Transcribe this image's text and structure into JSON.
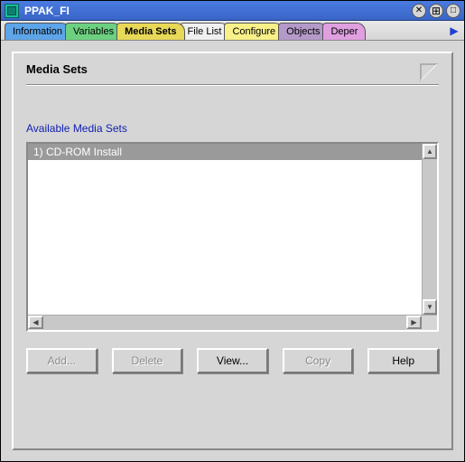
{
  "window": {
    "title": "PPAK_FI"
  },
  "tabs": [
    {
      "label": "Information"
    },
    {
      "label": "Variables"
    },
    {
      "label": "Media Sets",
      "active": true
    },
    {
      "label": "File List"
    },
    {
      "label": "Configure"
    },
    {
      "label": "Objects"
    },
    {
      "label": "Deper"
    }
  ],
  "panel": {
    "title": "Media Sets",
    "section_label": "Available Media Sets",
    "items": [
      {
        "label": "1)  CD-ROM Install"
      }
    ]
  },
  "buttons": {
    "add": {
      "label": "Add...",
      "enabled": false
    },
    "delete": {
      "label": "Delete",
      "enabled": false
    },
    "view": {
      "label": "View...",
      "enabled": true
    },
    "copy": {
      "label": "Copy",
      "enabled": false
    },
    "help": {
      "label": "Help",
      "enabled": true
    }
  }
}
